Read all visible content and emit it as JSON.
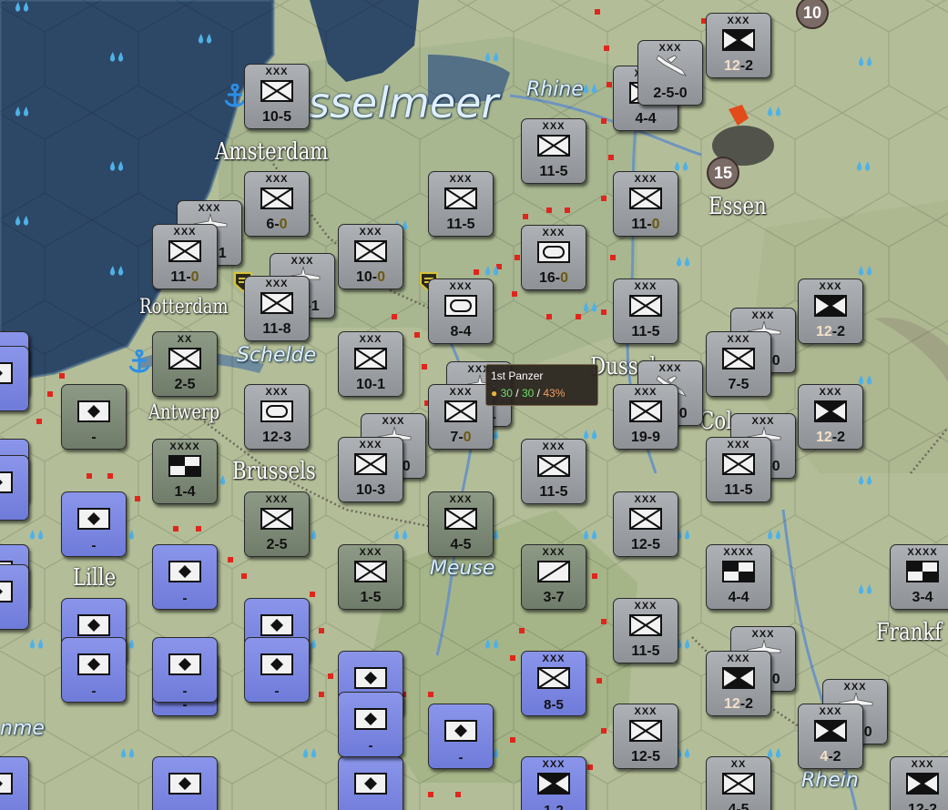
{
  "colors": {
    "sea": "#2d4766",
    "land": "#b3be98",
    "allied_counter": "#7b86e3",
    "axis_counter": "#9ea2a7",
    "allied_front": "#e0261c"
  },
  "map_labels": {
    "ijsselmeer": "sselmeer",
    "amsterdam": "Amsterdam",
    "rotterdam": "Rotterdam",
    "antwerp": "Antwerp",
    "brussels": "Brussels",
    "lille": "Lille",
    "essen": "Essen",
    "dusseldorf": "Dussel",
    "cologne": "Col",
    "frankfurt": "Frankf",
    "rhine": "Rhine",
    "schelde": "Schelde",
    "meuse": "Meuse",
    "rhein": "Rhein",
    "somme": "nme"
  },
  "victory_points": {
    "essen": "15",
    "top_right": "10"
  },
  "tooltip": {
    "unit_name": "1st Panzer",
    "strength": "30",
    "max_strength": "30",
    "efficiency": "43%",
    "sep1": " / ",
    "sep2": " / "
  },
  "units": [
    {
      "size": "XXX",
      "stats": "10-5"
    },
    {
      "size": "XXX",
      "stats": "6-",
      "stats_b": "0"
    },
    {
      "size": "XXX",
      "stats": "5-1-1"
    },
    {
      "size": "XXX",
      "stats": "11-",
      "stats_b": "0"
    },
    {
      "size": "XXX",
      "stats": "5-1-1"
    },
    {
      "size": "XXX",
      "stats": "11-8"
    },
    {
      "size": "XXX",
      "stats": "10-",
      "stats_b": "0"
    },
    {
      "size": "XXX",
      "stats": "11-5"
    },
    {
      "size": "XXX",
      "stats": "11-5"
    },
    {
      "size": "XXX",
      "stats": "16-",
      "stats_b": "0"
    },
    {
      "size": "XXX",
      "stats": "8-4"
    },
    {
      "size": "XXX",
      "stats": "10-1"
    },
    {
      "size": "XX",
      "stats": "2-5"
    },
    {
      "size": "XXX",
      "stats": "12-3"
    },
    {
      "size": "XXX",
      "stats": "5-1-1"
    },
    {
      "size": "XXX",
      "stats": "7-",
      "stats_b": "0"
    },
    {
      "size": "XXX",
      "stats": "4-1-0"
    },
    {
      "size": "XXX",
      "stats": "10-3"
    },
    {
      "size": "XXXX",
      "stats": "1-4"
    },
    {
      "size": "XXX",
      "stats": "2-5"
    },
    {
      "size": "XXX",
      "stats": "1-5"
    },
    {
      "size": "XXX",
      "stats": "4-5"
    },
    {
      "size": "XXX",
      "stats": "11-5"
    },
    {
      "size": "XXX",
      "stats": "3-7"
    },
    {
      "size": "XXX",
      "stats": "4-4"
    },
    {
      "size": "XXX",
      "stats": "2-5-0"
    },
    {
      "size": "XXX",
      "stats_a": "12",
      "stats": "-2"
    },
    {
      "size": "XXX",
      "stats": "11-",
      "stats_b": "0"
    },
    {
      "size": "XXX",
      "stats": "11-5"
    },
    {
      "size": "XXX",
      "stats": "3-6-0"
    },
    {
      "size": "XXX",
      "stats": "19-9"
    },
    {
      "size": "XXX",
      "stats": "12-5"
    },
    {
      "size": "XXX",
      "stats": "11-5"
    },
    {
      "size": "XXX",
      "stats": "8-5"
    },
    {
      "size": "XXX",
      "stats": "12-5"
    },
    {
      "size": "XXX",
      "stats": "3-4-0"
    },
    {
      "size": "XXX",
      "stats": "7-5"
    },
    {
      "size": "XXX",
      "stats_a": "12",
      "stats": "-2"
    },
    {
      "size": "XXX",
      "stats": "2-3-0"
    },
    {
      "size": "XXX",
      "stats": "11-5"
    },
    {
      "size": "XXX",
      "stats_a": "12",
      "stats": "-2"
    },
    {
      "size": "XXXX",
      "stats": "4-4"
    },
    {
      "size": "XXX",
      "stats": "3-3-0"
    },
    {
      "size": "XXX",
      "stats_a": "12",
      "stats": "-2"
    },
    {
      "size": "XXX",
      "stats": "3-4-0"
    },
    {
      "size": "XXX",
      "stats_a": "4",
      "stats": "-2"
    },
    {
      "size": "XXXX",
      "stats": "3-4"
    },
    {
      "size": "XX",
      "stats": "4-5"
    },
    {
      "size": "XXX",
      "stats": "12-2"
    },
    {
      "size": "XXX",
      "stats": "1-2"
    },
    {
      "size": "",
      "stats": "-"
    },
    {
      "size": "",
      "stats": "-"
    },
    {
      "size": "",
      "stats": "-"
    },
    {
      "size": "",
      "stats": "-"
    },
    {
      "size": "",
      "stats": "-"
    },
    {
      "size": "",
      "stats": "-"
    },
    {
      "size": "",
      "stats": "-"
    },
    {
      "size": "",
      "stats": "-"
    },
    {
      "size": "",
      "stats": "-"
    },
    {
      "size": "",
      "stats": "-"
    },
    {
      "size": "",
      "stats": "-"
    },
    {
      "size": "",
      "stats": "-"
    },
    {
      "size": "",
      "stats": "-"
    },
    {
      "size": "",
      "stats": "-"
    },
    {
      "size": "",
      "stats": "-"
    },
    {
      "size": "",
      "stats": "-"
    },
    {
      "size": "",
      "stats": "-"
    },
    {
      "size": "",
      "stats": "-"
    },
    {
      "size": "",
      "stats": "-"
    },
    {
      "size": "",
      "stats": "-"
    },
    {
      "size": "",
      "stats": "-"
    }
  ]
}
